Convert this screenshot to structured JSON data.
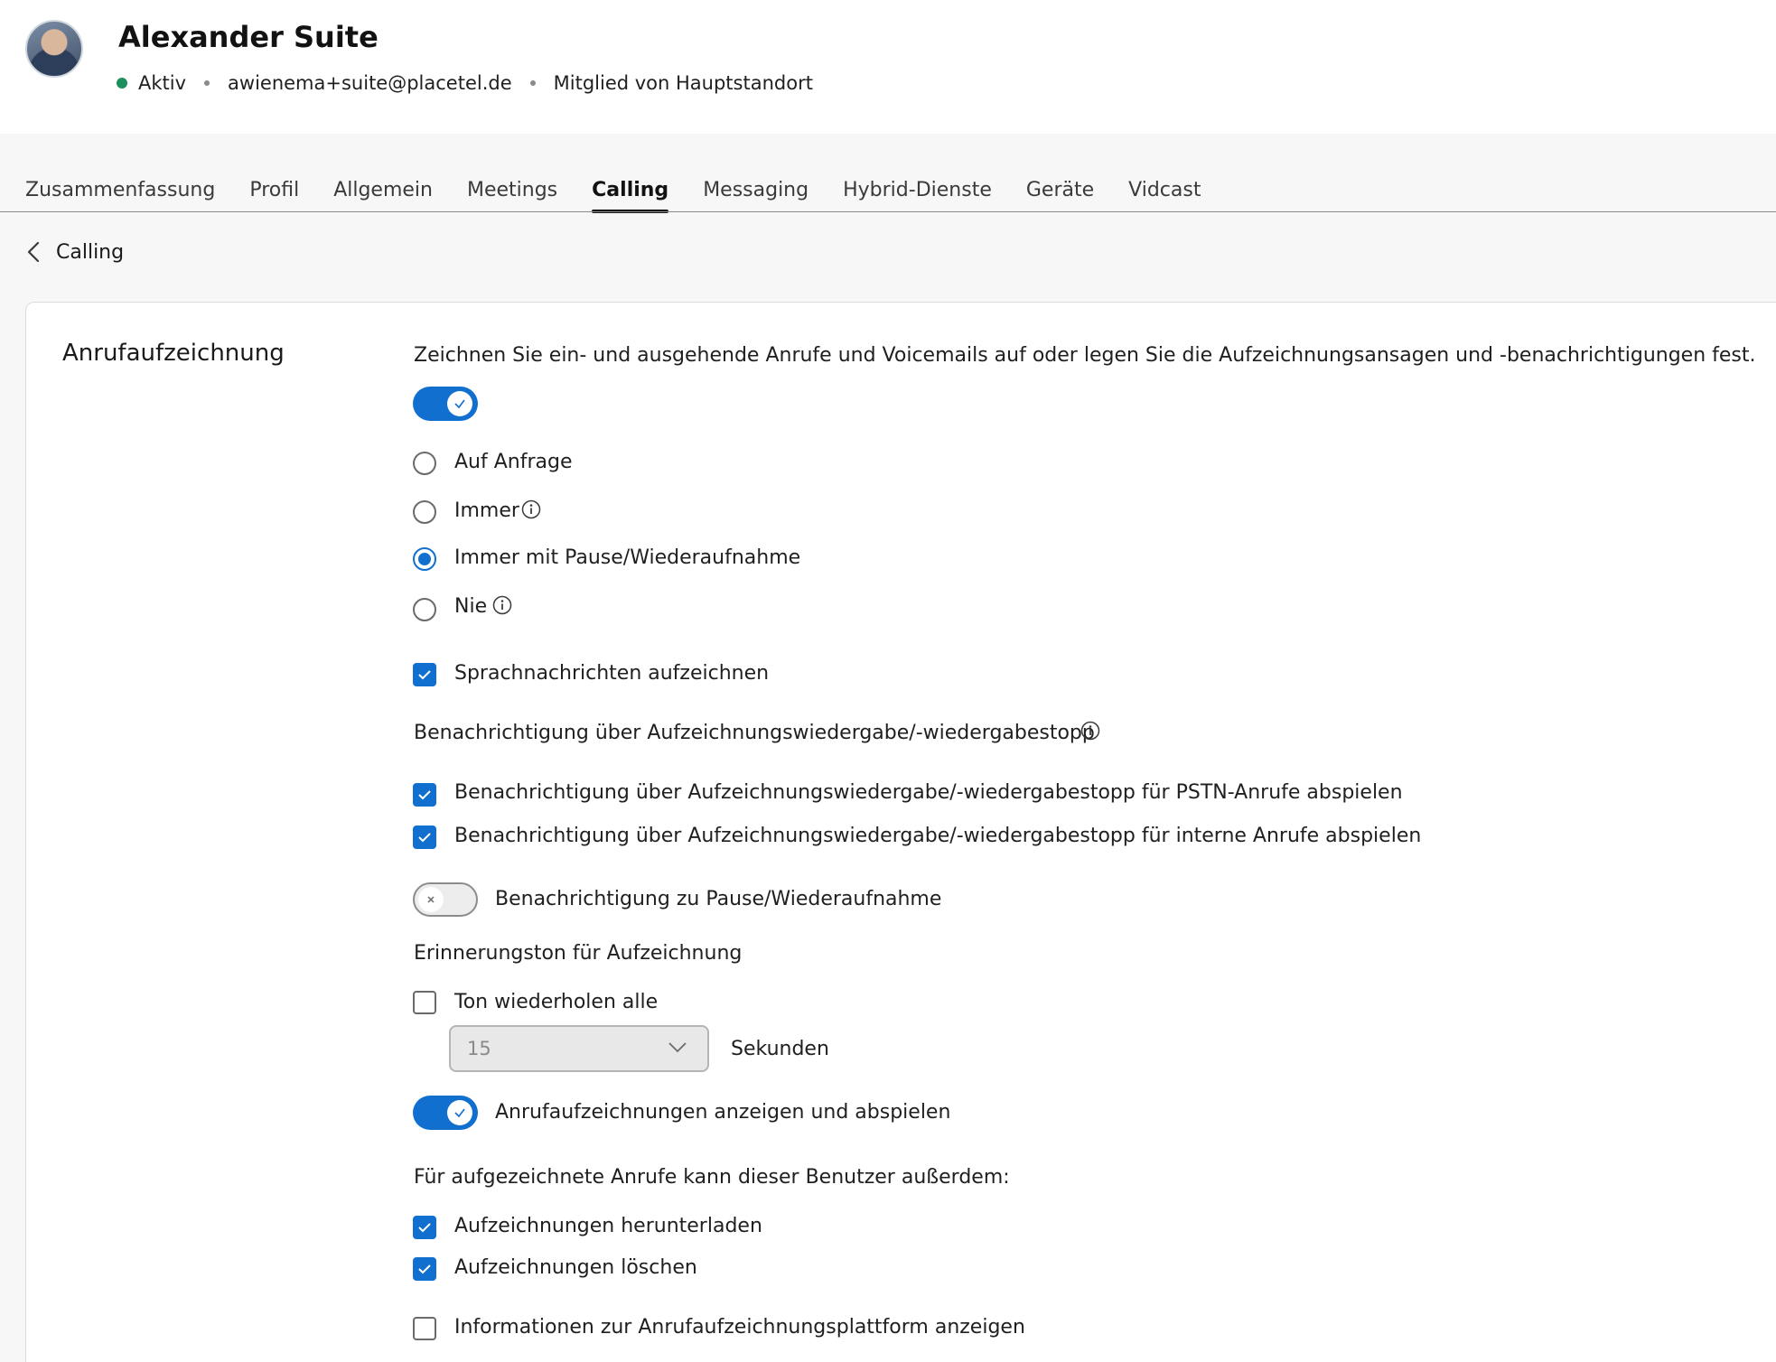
{
  "user": {
    "name": "Alexander Suite",
    "status": "Aktiv",
    "email": "awienema+suite@placetel.de",
    "membership": "Mitglied von Hauptstandort"
  },
  "tabs": [
    {
      "label": "Zusammenfassung",
      "active": false
    },
    {
      "label": "Profil",
      "active": false
    },
    {
      "label": "Allgemein",
      "active": false
    },
    {
      "label": "Meetings",
      "active": false
    },
    {
      "label": "Calling",
      "active": true
    },
    {
      "label": "Messaging",
      "active": false
    },
    {
      "label": "Hybrid-Dienste",
      "active": false
    },
    {
      "label": "Geräte",
      "active": false
    },
    {
      "label": "Vidcast",
      "active": false
    }
  ],
  "back": {
    "label": "Calling"
  },
  "section": {
    "title": "Anrufaufzeichnung",
    "description": "Zeichnen Sie ein- und ausgehende Anrufe und Voicemails auf oder legen Sie die Aufzeichnungsansagen und -benachrichtigungen fest.",
    "recording_enabled": true,
    "mode_options": [
      {
        "label": "Auf Anfrage",
        "checked": false,
        "info": false
      },
      {
        "label": "Immer",
        "checked": false,
        "info": true
      },
      {
        "label": "Immer mit Pause/Wiederaufnahme",
        "checked": true,
        "info": false
      },
      {
        "label": "Nie",
        "checked": false,
        "info": true
      }
    ],
    "record_voicemail": {
      "label": "Sprachnachrichten aufzeichnen",
      "checked": true
    },
    "notification_heading": "Benachrichtigung über Aufzeichnungswiedergabe/-wiedergabestopp",
    "notification_pstn": {
      "label": "Benachrichtigung über Aufzeichnungswiedergabe/-wiedergabestopp für PSTN-Anrufe abspielen",
      "checked": true
    },
    "notification_internal": {
      "label": "Benachrichtigung über Aufzeichnungswiedergabe/-wiedergabestopp für interne Anrufe abspielen",
      "checked": true
    },
    "pause_notification": {
      "label": "Benachrichtigung zu Pause/Wiederaufnahme",
      "enabled": false
    },
    "reminder_heading": "Erinnerungston für Aufzeichnung",
    "repeat_tone": {
      "label": "Ton wiederholen alle",
      "checked": false
    },
    "interval": {
      "value": "15",
      "unit": "Sekunden"
    },
    "show_play": {
      "label": "Anrufaufzeichnungen anzeigen und abspielen",
      "enabled": true
    },
    "user_can_heading": "Für aufgezeichnete Anrufe kann dieser Benutzer außerdem:",
    "download": {
      "label": "Aufzeichnungen herunterladen",
      "checked": true
    },
    "delete": {
      "label": "Aufzeichnungen löschen",
      "checked": true
    },
    "platform_info": {
      "label": "Informationen zur Anrufaufzeichnungsplattform anzeigen",
      "checked": false
    }
  },
  "colors": {
    "accent": "#1170cf",
    "status_active": "#1d8f5a"
  }
}
